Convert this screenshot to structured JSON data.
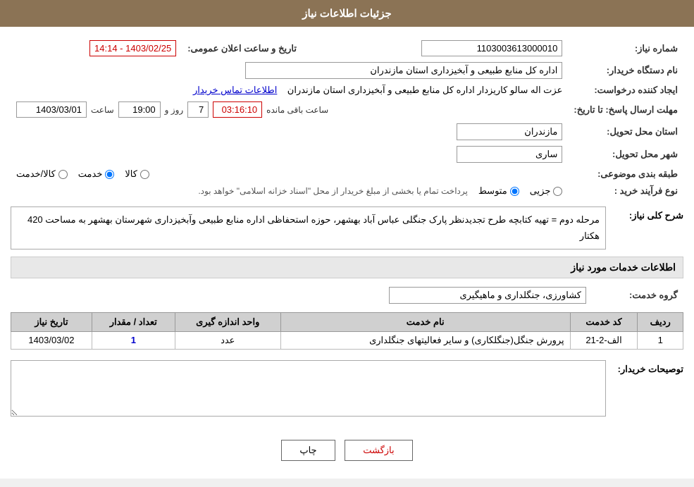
{
  "header": {
    "title": "جزئیات اطلاعات نیاز"
  },
  "fields": {
    "shomara_niaz_label": "شماره نیاز:",
    "shomara_niaz_value": "1103003613000010",
    "nam_dastgah_label": "نام دستگاه خریدار:",
    "nam_dastgah_value": "اداره کل منابع طبیعی و آبخیزداری استان مازندران",
    "ijad_konande_label": "ایجاد کننده درخواست:",
    "ijad_konande_value": "عزت اله سالو کاریزدار اداره کل منابع طبیعی و آبخیزداری استان مازندران",
    "ettelaat_tamas_label": "اطلاعات تماس خریدار",
    "mohlat_ersal_label": "مهلت ارسال پاسخ: تا تاریخ:",
    "date_value": "1403/03/01",
    "saat_label": "ساعت",
    "saat_value": "19:00",
    "roz_label": "روز و",
    "roz_value": "7",
    "baqi_mande_label": "ساعت باقی مانده",
    "baqi_value": "03:16:10",
    "tarikh_saat_label": "تاریخ و ساعت اعلان عمومی:",
    "tarikh_saat_value": "1403/02/25 - 14:14",
    "ostan_tahvil_label": "استان محل تحویل:",
    "ostan_tahvil_value": "مازندران",
    "shahr_tahvil_label": "شهر محل تحویل:",
    "shahr_tahvil_value": "ساری",
    "tabaghebandi_label": "طبقه بندی موضوعی:",
    "kala_label": "کالا",
    "khedmat_label": "خدمت",
    "kala_khedmat_label": "کالا/خدمت",
    "noee_farayand_label": "نوع فرآیند خرید :",
    "jozee_label": "جزیی",
    "motavaset_label": "متوسط",
    "pardakht_text": "پرداخت تمام یا بخشی از مبلغ خریدار از محل \"اسناد خزانه اسلامی\" خواهد بود.",
    "sharh_label": "شرح کلی نیاز:",
    "sharh_value": "مرحله دوم = تهیه کتابچه طرح تجدیدنظر پارک جنگلی عباس آباد بهشهر، حوزه استحفاظی اداره منابع طبیعی وآبخیزداری شهرستان بهشهر به مساحت 420 هکتار",
    "ettelaat_khadamat_label": "اطلاعات خدمات مورد نیاز",
    "goroh_khedmat_label": "گروه خدمت:",
    "goroh_khedmat_value": "کشاورزی، جنگلداری و ماهیگیری",
    "table_headers": {
      "radif": "ردیف",
      "code_khedmat": "کد خدمت",
      "nam_khedmat": "نام خدمت",
      "vahed": "واحد اندازه گیری",
      "tedad": "تعداد / مقدار",
      "tarikh": "تاریخ نیاز"
    },
    "table_rows": [
      {
        "radif": "1",
        "code_khedmat": "الف-2-21",
        "nam_khedmat": "پرورش جنگل(جنگلکاری) و سایر فعالیتهای جنگلداری",
        "vahed": "عدد",
        "tedad": "1",
        "tarikh": "1403/03/02"
      }
    ],
    "tosiheat_label": "توصیحات خریدار:",
    "print_btn": "چاپ",
    "back_btn": "بازگشت"
  }
}
